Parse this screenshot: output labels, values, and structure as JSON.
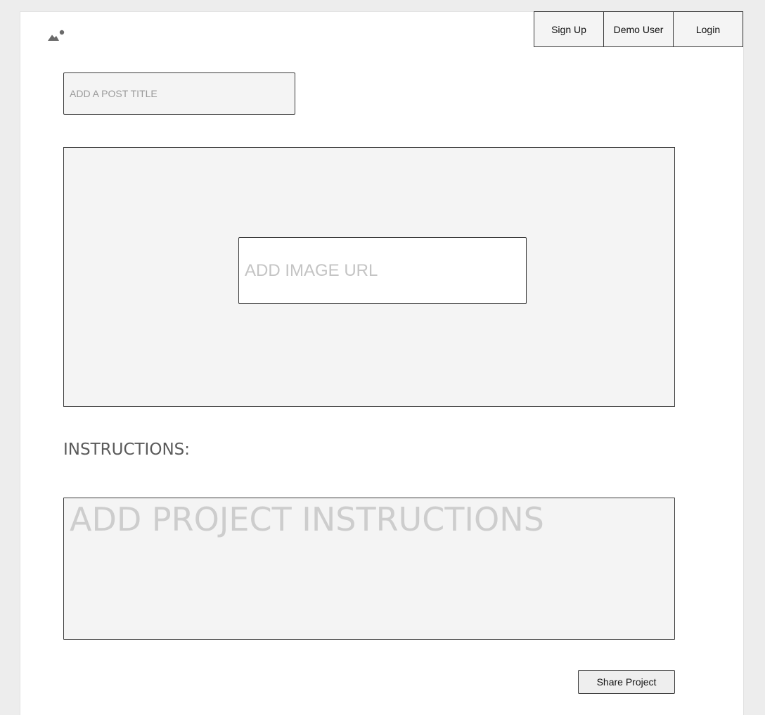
{
  "logo": {
    "icon": "mountain-sun-icon"
  },
  "nav": {
    "sign_up": "Sign Up",
    "demo_user": "Demo User",
    "login": "Login"
  },
  "form": {
    "title_placeholder": "ADD A POST TITLE",
    "title_value": "",
    "image_url_placeholder": "ADD IMAGE URL",
    "image_url_value": "",
    "instructions_heading": "INSTRUCTIONS:",
    "instructions_placeholder": "ADD PROJECT INSTRUCTIONS",
    "instructions_value": "",
    "share_label": "Share Project"
  },
  "colors": {
    "background": "#ededed",
    "page": "#ffffff",
    "field": "#f4f4f4",
    "border": "#3a3a3a",
    "heading": "#5a5a5a"
  }
}
